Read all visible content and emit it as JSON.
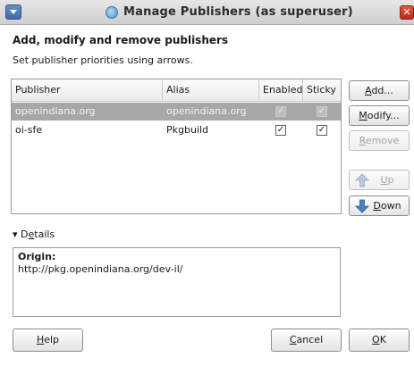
{
  "window": {
    "title": "Manage Publishers (as superuser)",
    "close_glyph": "✕"
  },
  "header": {
    "title": "Add, modify and remove publishers",
    "subtitle": "Set publisher priorities using arrows."
  },
  "table": {
    "columns": [
      "Publisher",
      "Alias",
      "Enabled",
      "Sticky"
    ],
    "rows": [
      {
        "publisher": "openindiana.org",
        "alias": "openindiana.org",
        "enabled": true,
        "sticky": true,
        "selected": true
      },
      {
        "publisher": "oi-sfe",
        "alias": "Pkgbuild",
        "enabled": true,
        "sticky": true,
        "selected": false
      }
    ],
    "check_glyph": "✓"
  },
  "buttons": {
    "add": {
      "mnemonic": "A",
      "rest": "dd..."
    },
    "modify": {
      "mnemonic": "M",
      "rest": "odify..."
    },
    "remove": {
      "mnemonic": "R",
      "rest": "emove"
    },
    "up": {
      "mnemonic": "U",
      "rest": "p"
    },
    "down": {
      "mnemonic": "D",
      "rest": "own"
    },
    "help": {
      "mnemonic": "H",
      "rest": "elp"
    },
    "cancel": {
      "mnemonic": "C",
      "rest": "ancel"
    },
    "ok": {
      "mnemonic": "O",
      "rest": "K"
    }
  },
  "details": {
    "toggle_prefix": "D",
    "toggle_mnemonic": "e",
    "toggle_rest": "tails",
    "expanded_glyph": "▾",
    "origin_label": "Origin:",
    "origin_url": "http://pkg.openindiana.org/dev-il/"
  },
  "icons": {
    "window_menu": "window-menu-icon",
    "title": "package-manager-icon",
    "up": "up-arrow-icon",
    "down": "down-arrow-icon"
  },
  "colors": {
    "selected_row": "#a7a7a7",
    "close_button": "#c63a26",
    "arrow_blue": "#4a7fc1"
  }
}
